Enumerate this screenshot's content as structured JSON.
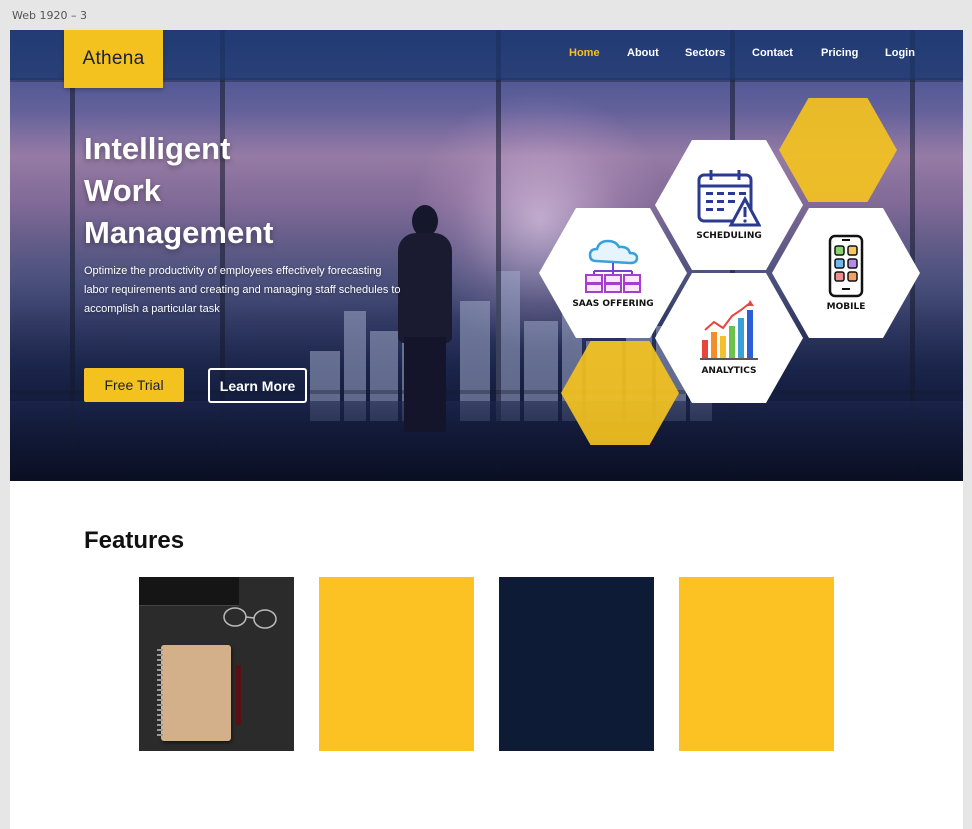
{
  "frame_label": "Web 1920 – 3",
  "brand": {
    "logo_text": "Athena",
    "accent": "#f4c21f",
    "dark": "#0d1b36"
  },
  "nav": {
    "items": [
      {
        "label": "Home",
        "active": true
      },
      {
        "label": "About",
        "active": false
      },
      {
        "label": "Sectors",
        "active": false
      },
      {
        "label": "Contact",
        "active": false
      },
      {
        "label": "Pricing",
        "active": false
      },
      {
        "label": "Login",
        "active": false
      }
    ]
  },
  "hero": {
    "title_line1": "Intelligent",
    "title_line2": "Work",
    "title_line3": "Management",
    "description": "Optimize the productivity of employees effectively forecasting labor requirements and creating and managing staff schedules to accomplish a particular task",
    "primary_button": "Free Trial",
    "secondary_button": "Learn More"
  },
  "hexagons": [
    {
      "label": "SCHEDULING",
      "icon": "calendar-warning-icon"
    },
    {
      "label": "SAAS OFFERING",
      "icon": "cloud-servers-icon"
    },
    {
      "label": "MOBILE",
      "icon": "smartphone-apps-icon"
    },
    {
      "label": "ANALYTICS",
      "icon": "bar-chart-icon"
    }
  ],
  "features": {
    "title": "Features",
    "cards": [
      {
        "kind": "photo",
        "color": "#2b2b2b"
      },
      {
        "kind": "color",
        "color": "#fcc223"
      },
      {
        "kind": "color",
        "color": "#0d1b36"
      },
      {
        "kind": "color",
        "color": "#fcc223"
      }
    ]
  }
}
